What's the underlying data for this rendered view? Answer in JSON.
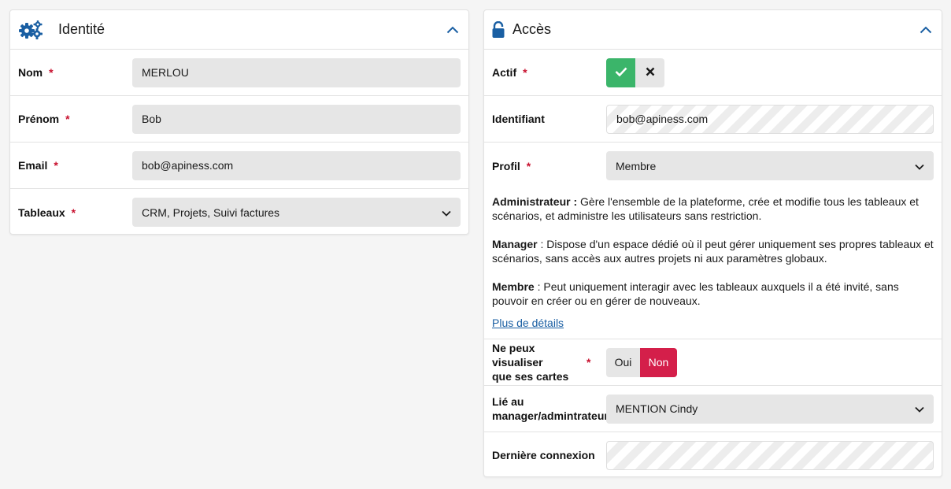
{
  "identity": {
    "title": "Identité",
    "fields": {
      "nom": {
        "label": "Nom",
        "value": "MERLOU"
      },
      "prenom": {
        "label": "Prénom",
        "value": "Bob"
      },
      "email": {
        "label": "Email",
        "value": "bob@apiness.com"
      },
      "tableaux": {
        "label": "Tableaux",
        "value": "CRM, Projets, Suivi factures"
      }
    },
    "required_mark": "*"
  },
  "access": {
    "title": "Accès",
    "actif": {
      "label": "Actif"
    },
    "identifiant": {
      "label": "Identifiant",
      "value": "bob@apiness.com"
    },
    "profil": {
      "label": "Profil",
      "value": "Membre"
    },
    "descriptions": {
      "admin_term": "Administrateur :",
      "admin_text": " Gère l'ensemble de la plateforme, crée et modifie tous les tableaux et scénarios, et administre les utilisateurs sans restriction.",
      "manager_term": "Manager",
      "manager_text": " : Dispose d'un espace dédié où il peut gérer uniquement ses propres tableaux et scénarios, sans accès aux autres projets ni aux paramètres globaux.",
      "member_term": "Membre",
      "member_text": " : Peut uniquement interagir avec les tableaux auxquels il a été invité, sans pouvoir en créer ou en gérer de nouveaux.",
      "details_link": "Plus de détails"
    },
    "visualise": {
      "label_line1": "Ne peux visualiser",
      "label_line2": "que ses cartes",
      "oui": "Oui",
      "non": "Non",
      "selected": "Non"
    },
    "lie": {
      "label_line1": "Lié au",
      "label_line2": "manager/admintrateur",
      "value": "MENTION Cindy"
    },
    "derniere": {
      "label": "Dernière connexion",
      "value": ""
    }
  },
  "colors": {
    "accent_blue": "#1a5fa3",
    "required_red": "#c8102e",
    "active_green": "#3bb56a",
    "non_red": "#d41f4a"
  },
  "icons": {
    "identity": "gears-icon",
    "access": "unlock-icon",
    "collapse": "chevron-up-icon",
    "select": "chevron-down-icon",
    "yes": "check-icon",
    "no": "close-icon"
  }
}
